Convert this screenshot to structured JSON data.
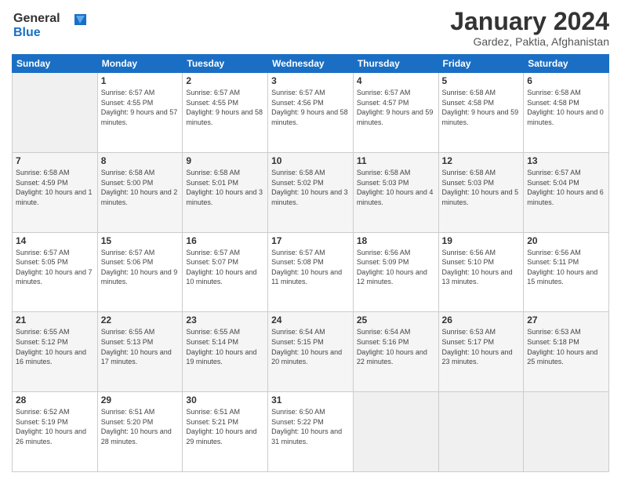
{
  "header": {
    "logo_line1": "General",
    "logo_line2": "Blue",
    "title": "January 2024",
    "subtitle": "Gardez, Paktia, Afghanistan"
  },
  "days_of_week": [
    "Sunday",
    "Monday",
    "Tuesday",
    "Wednesday",
    "Thursday",
    "Friday",
    "Saturday"
  ],
  "weeks": [
    [
      {
        "day": "",
        "sunrise": "",
        "sunset": "",
        "daylight": "",
        "empty": true
      },
      {
        "day": "1",
        "sunrise": "Sunrise: 6:57 AM",
        "sunset": "Sunset: 4:55 PM",
        "daylight": "Daylight: 9 hours and 57 minutes."
      },
      {
        "day": "2",
        "sunrise": "Sunrise: 6:57 AM",
        "sunset": "Sunset: 4:55 PM",
        "daylight": "Daylight: 9 hours and 58 minutes."
      },
      {
        "day": "3",
        "sunrise": "Sunrise: 6:57 AM",
        "sunset": "Sunset: 4:56 PM",
        "daylight": "Daylight: 9 hours and 58 minutes."
      },
      {
        "day": "4",
        "sunrise": "Sunrise: 6:57 AM",
        "sunset": "Sunset: 4:57 PM",
        "daylight": "Daylight: 9 hours and 59 minutes."
      },
      {
        "day": "5",
        "sunrise": "Sunrise: 6:58 AM",
        "sunset": "Sunset: 4:58 PM",
        "daylight": "Daylight: 9 hours and 59 minutes."
      },
      {
        "day": "6",
        "sunrise": "Sunrise: 6:58 AM",
        "sunset": "Sunset: 4:58 PM",
        "daylight": "Daylight: 10 hours and 0 minutes."
      }
    ],
    [
      {
        "day": "7",
        "sunrise": "Sunrise: 6:58 AM",
        "sunset": "Sunset: 4:59 PM",
        "daylight": "Daylight: 10 hours and 1 minute."
      },
      {
        "day": "8",
        "sunrise": "Sunrise: 6:58 AM",
        "sunset": "Sunset: 5:00 PM",
        "daylight": "Daylight: 10 hours and 2 minutes."
      },
      {
        "day": "9",
        "sunrise": "Sunrise: 6:58 AM",
        "sunset": "Sunset: 5:01 PM",
        "daylight": "Daylight: 10 hours and 3 minutes."
      },
      {
        "day": "10",
        "sunrise": "Sunrise: 6:58 AM",
        "sunset": "Sunset: 5:02 PM",
        "daylight": "Daylight: 10 hours and 3 minutes."
      },
      {
        "day": "11",
        "sunrise": "Sunrise: 6:58 AM",
        "sunset": "Sunset: 5:03 PM",
        "daylight": "Daylight: 10 hours and 4 minutes."
      },
      {
        "day": "12",
        "sunrise": "Sunrise: 6:58 AM",
        "sunset": "Sunset: 5:03 PM",
        "daylight": "Daylight: 10 hours and 5 minutes."
      },
      {
        "day": "13",
        "sunrise": "Sunrise: 6:57 AM",
        "sunset": "Sunset: 5:04 PM",
        "daylight": "Daylight: 10 hours and 6 minutes."
      }
    ],
    [
      {
        "day": "14",
        "sunrise": "Sunrise: 6:57 AM",
        "sunset": "Sunset: 5:05 PM",
        "daylight": "Daylight: 10 hours and 7 minutes."
      },
      {
        "day": "15",
        "sunrise": "Sunrise: 6:57 AM",
        "sunset": "Sunset: 5:06 PM",
        "daylight": "Daylight: 10 hours and 9 minutes."
      },
      {
        "day": "16",
        "sunrise": "Sunrise: 6:57 AM",
        "sunset": "Sunset: 5:07 PM",
        "daylight": "Daylight: 10 hours and 10 minutes."
      },
      {
        "day": "17",
        "sunrise": "Sunrise: 6:57 AM",
        "sunset": "Sunset: 5:08 PM",
        "daylight": "Daylight: 10 hours and 11 minutes."
      },
      {
        "day": "18",
        "sunrise": "Sunrise: 6:56 AM",
        "sunset": "Sunset: 5:09 PM",
        "daylight": "Daylight: 10 hours and 12 minutes."
      },
      {
        "day": "19",
        "sunrise": "Sunrise: 6:56 AM",
        "sunset": "Sunset: 5:10 PM",
        "daylight": "Daylight: 10 hours and 13 minutes."
      },
      {
        "day": "20",
        "sunrise": "Sunrise: 6:56 AM",
        "sunset": "Sunset: 5:11 PM",
        "daylight": "Daylight: 10 hours and 15 minutes."
      }
    ],
    [
      {
        "day": "21",
        "sunrise": "Sunrise: 6:55 AM",
        "sunset": "Sunset: 5:12 PM",
        "daylight": "Daylight: 10 hours and 16 minutes."
      },
      {
        "day": "22",
        "sunrise": "Sunrise: 6:55 AM",
        "sunset": "Sunset: 5:13 PM",
        "daylight": "Daylight: 10 hours and 17 minutes."
      },
      {
        "day": "23",
        "sunrise": "Sunrise: 6:55 AM",
        "sunset": "Sunset: 5:14 PM",
        "daylight": "Daylight: 10 hours and 19 minutes."
      },
      {
        "day": "24",
        "sunrise": "Sunrise: 6:54 AM",
        "sunset": "Sunset: 5:15 PM",
        "daylight": "Daylight: 10 hours and 20 minutes."
      },
      {
        "day": "25",
        "sunrise": "Sunrise: 6:54 AM",
        "sunset": "Sunset: 5:16 PM",
        "daylight": "Daylight: 10 hours and 22 minutes."
      },
      {
        "day": "26",
        "sunrise": "Sunrise: 6:53 AM",
        "sunset": "Sunset: 5:17 PM",
        "daylight": "Daylight: 10 hours and 23 minutes."
      },
      {
        "day": "27",
        "sunrise": "Sunrise: 6:53 AM",
        "sunset": "Sunset: 5:18 PM",
        "daylight": "Daylight: 10 hours and 25 minutes."
      }
    ],
    [
      {
        "day": "28",
        "sunrise": "Sunrise: 6:52 AM",
        "sunset": "Sunset: 5:19 PM",
        "daylight": "Daylight: 10 hours and 26 minutes."
      },
      {
        "day": "29",
        "sunrise": "Sunrise: 6:51 AM",
        "sunset": "Sunset: 5:20 PM",
        "daylight": "Daylight: 10 hours and 28 minutes."
      },
      {
        "day": "30",
        "sunrise": "Sunrise: 6:51 AM",
        "sunset": "Sunset: 5:21 PM",
        "daylight": "Daylight: 10 hours and 29 minutes."
      },
      {
        "day": "31",
        "sunrise": "Sunrise: 6:50 AM",
        "sunset": "Sunset: 5:22 PM",
        "daylight": "Daylight: 10 hours and 31 minutes."
      },
      {
        "day": "",
        "sunrise": "",
        "sunset": "",
        "daylight": "",
        "empty": true
      },
      {
        "day": "",
        "sunrise": "",
        "sunset": "",
        "daylight": "",
        "empty": true
      },
      {
        "day": "",
        "sunrise": "",
        "sunset": "",
        "daylight": "",
        "empty": true
      }
    ]
  ]
}
